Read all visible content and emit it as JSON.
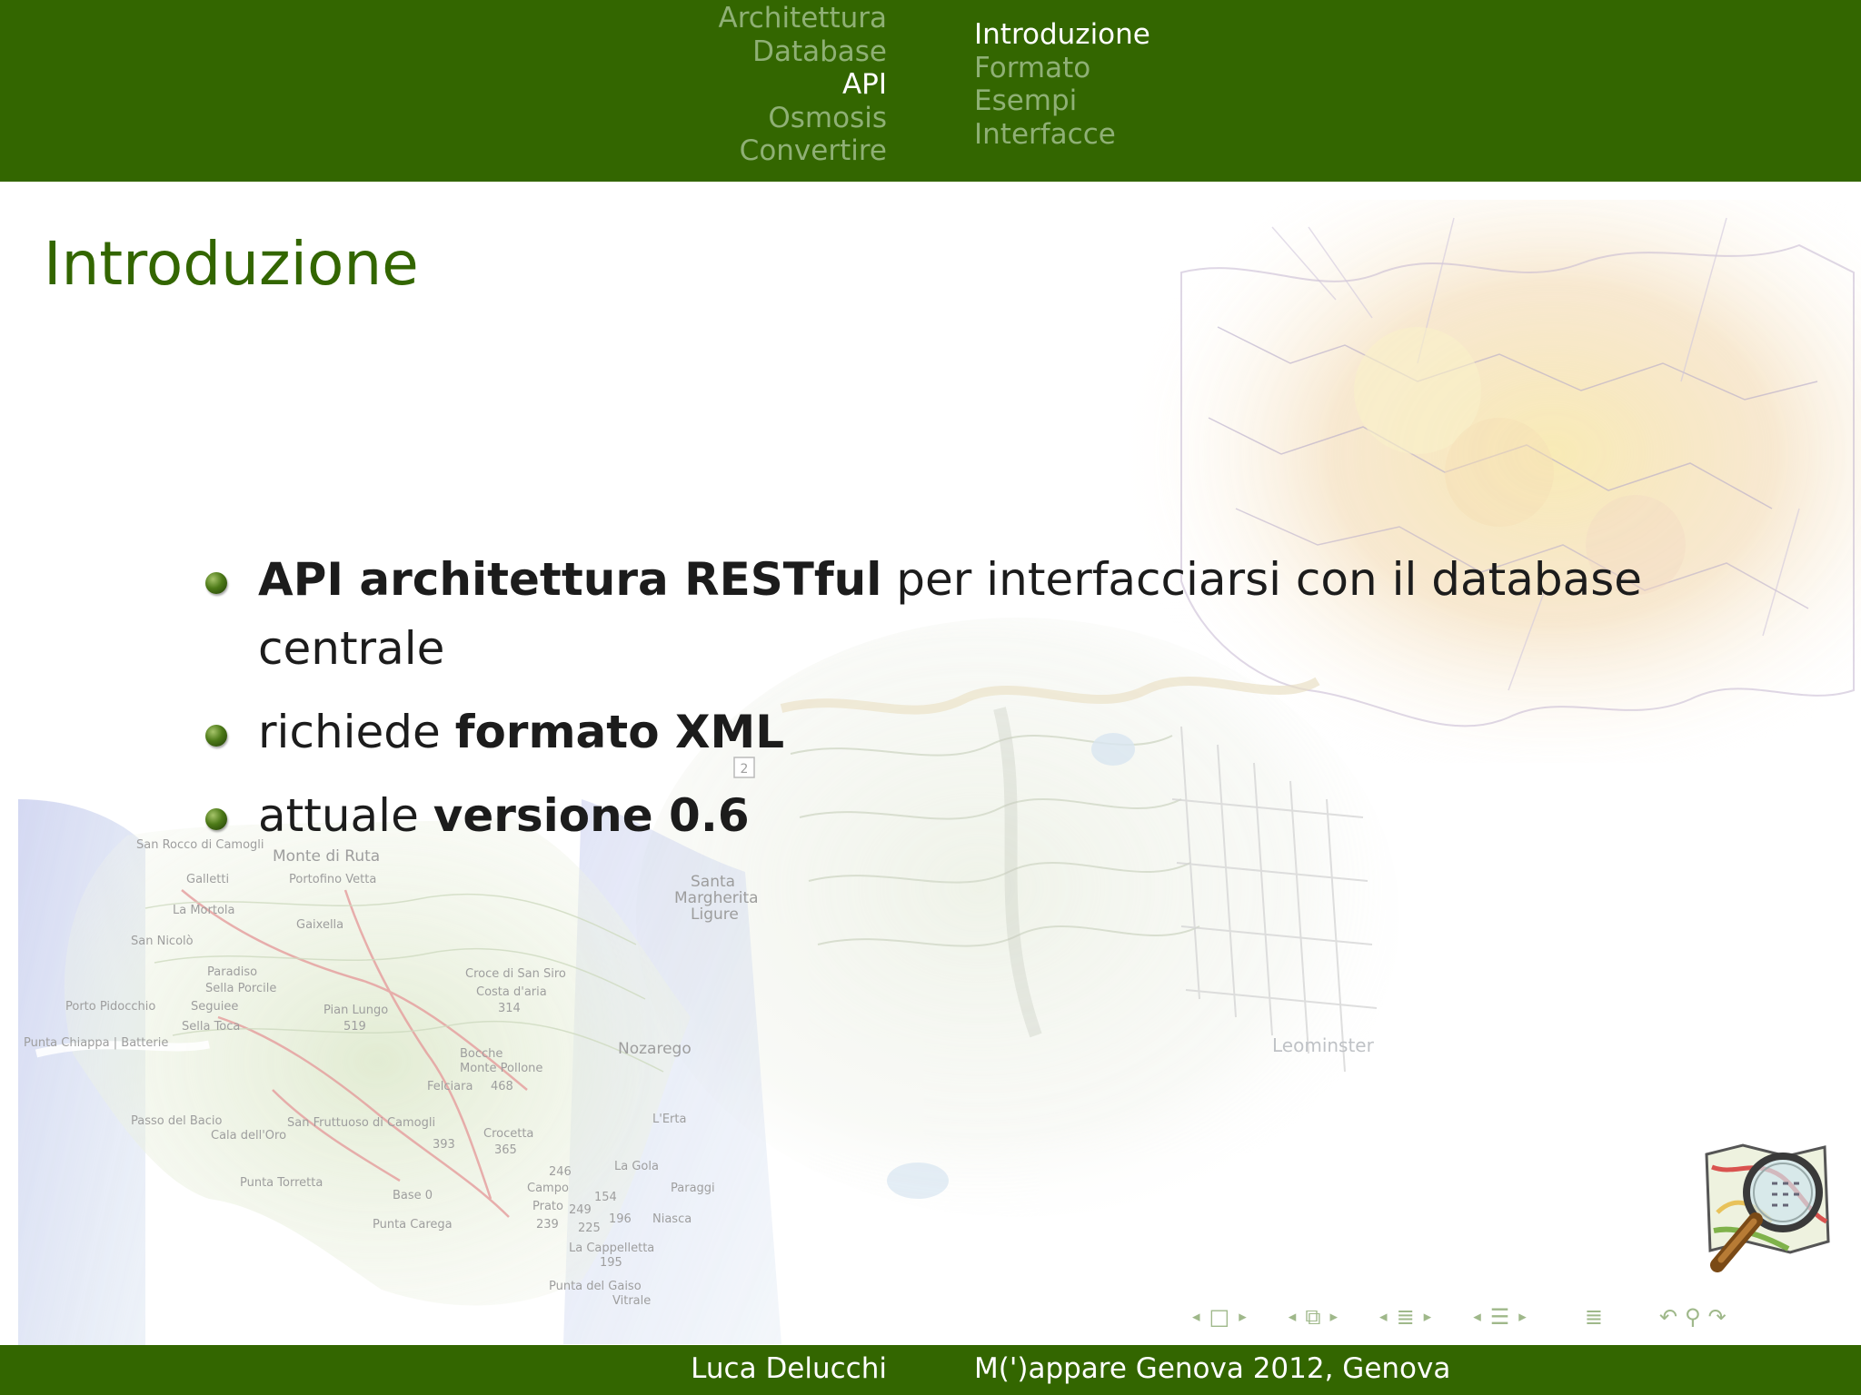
{
  "theme": {
    "brand_color": "#336600",
    "title_color": "#336600",
    "inactive_nav_color": "#8fb075"
  },
  "header": {
    "sections": [
      {
        "label": "Architettura",
        "active": false
      },
      {
        "label": "Database",
        "active": false
      },
      {
        "label": "API",
        "active": true
      },
      {
        "label": "Osmosis",
        "active": false
      },
      {
        "label": "Convertire",
        "active": false
      }
    ],
    "subsections": [
      {
        "label": "Introduzione",
        "active": true
      },
      {
        "label": "Formato",
        "active": false
      },
      {
        "label": "Esempi",
        "active": false
      },
      {
        "label": "Interfacce",
        "active": false
      }
    ]
  },
  "frame": {
    "title": "Introduzione",
    "bullets": [
      {
        "bold": "API architettura RESTful",
        "rest": " per interfacciarsi con il database centrale"
      },
      {
        "pre": "richiede ",
        "bold": "formato XML"
      },
      {
        "pre": "attuale ",
        "bold": "versione 0.6"
      }
    ]
  },
  "background": {
    "map_labels": [
      "San Rocco di Camogli",
      "Monte di Ruta",
      "Galletti",
      "Portofino Vetta",
      "La Mortola",
      "Gaixella",
      "San Nicolò",
      "Paradiso",
      "Sella Porcile",
      "Porto Pidocchio",
      "Seguiee",
      "Sella Toca",
      "Pian Lungo",
      "519",
      "Punta Chiappa",
      "Batterie",
      "Croce di San Siro",
      "Costa d'aria",
      "314",
      "Santa Margherita Ligure",
      "Bocche",
      "Monte Pollone",
      "Felciara",
      "468",
      "Nozarego",
      "Passo del Bacio",
      "Cala dell'Oro",
      "San Fruttuoso di Camogli",
      "393",
      "Crocetta",
      "365",
      "L'Erta",
      "Punta Torretta",
      "Base 0",
      "246",
      "Campo",
      "154",
      "La Gola",
      "Paraggi",
      "Prato",
      "249",
      "196",
      "Niasca",
      "239",
      "225",
      "Punta Carega",
      "La Cappelletta",
      "195",
      "Punta del Gaiso",
      "Vitrale",
      "Leominster"
    ],
    "road_shield": "2"
  },
  "logo": {
    "icon": "openstreetmap-logo"
  },
  "nav_symbols": [
    "slide-nav-icon",
    "frame-nav-icon",
    "subsection-nav-icon",
    "section-nav-icon",
    "document-nav-icon",
    "back-forward-search-icon"
  ],
  "footer": {
    "author": "Luca Delucchi",
    "title": "M(')appare Genova 2012, Genova"
  }
}
